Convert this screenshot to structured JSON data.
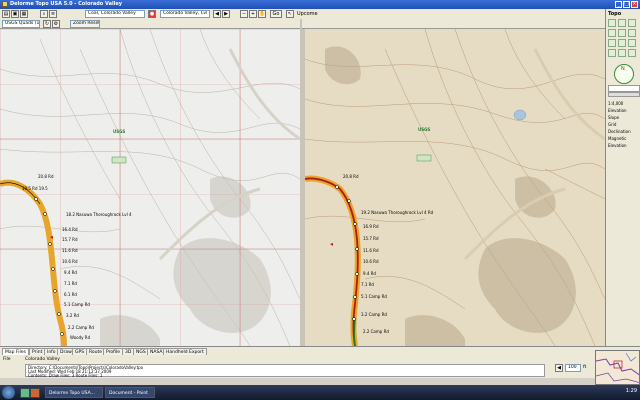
{
  "app": {
    "title": "Delorme Topo USA 5.0 - Colorado Valley",
    "icon": "app-icon",
    "window_controls": [
      "minimize-icon",
      "maximize-icon",
      "close-icon"
    ]
  },
  "toolbar": {
    "location_left": "Coal, Colorado Valley",
    "location_right": "Colorado Valley, Lvl 0 10",
    "zoom_label": "Go",
    "tab_label": "Upcome",
    "icons": [
      "open-icon",
      "save-icon",
      "print-icon",
      "find-icon",
      "layers-icon",
      "back-icon",
      "forward-icon"
    ]
  },
  "left_pane": {
    "map_source": "USGS Quads (1:24...)",
    "zoom_btn": "Zoom Reset",
    "region_label": "USGS",
    "labels": [
      {
        "text": "20.8 Rd"
      },
      {
        "text": "19.5 Rd 19.5"
      },
      {
        "text": "18.2 Nasuwa Thoroughrock Lvl 4"
      },
      {
        "text": "16.4 Rd"
      },
      {
        "text": "15.7 Rd"
      },
      {
        "text": "11.6 Rd"
      },
      {
        "text": "10.6 Rd"
      },
      {
        "text": "9.4 Rd"
      },
      {
        "text": "7.1 Rd"
      },
      {
        "text": "6.1 Rd"
      },
      {
        "text": "5.1 Camp Rd"
      },
      {
        "text": "3.2 Rd"
      },
      {
        "text": "2.2 Camp Rd"
      }
    ],
    "waypoint_labels": [
      "Woody Rd"
    ]
  },
  "right_pane": {
    "labels": [
      {
        "text": "20.8 Rd"
      },
      {
        "text": "19.2 Nasuwa Thoroughrock Lvl 4 Rd"
      },
      {
        "text": "16.9 Rd"
      },
      {
        "text": "15.7 Rd"
      },
      {
        "text": "11.6 Rd"
      },
      {
        "text": "10.6 Rd"
      },
      {
        "text": "9.4 Rd"
      },
      {
        "text": "7.1 Rd"
      },
      {
        "text": "5.1 Camp Rd"
      },
      {
        "text": "3.2 Camp Rd"
      },
      {
        "text": "2.2 Camp Rd"
      }
    ],
    "region_label": "USGS"
  },
  "side_panel": {
    "header": "Topo",
    "lines": [
      "1:4,000",
      "Elevation",
      "Slope",
      "Grid",
      "Declination",
      "Magnetic",
      "Elevation"
    ],
    "compass": "N"
  },
  "tabs": [
    {
      "label": "Map Files"
    },
    {
      "label": "Print"
    },
    {
      "label": "Info"
    },
    {
      "label": "Draw"
    },
    {
      "label": "GPS"
    },
    {
      "label": "Route"
    },
    {
      "label": "Profile"
    },
    {
      "label": "3D"
    },
    {
      "label": "NGS"
    },
    {
      "label": "NASA"
    },
    {
      "label": "Handheld Export"
    }
  ],
  "info": {
    "file_label": "File",
    "file_name": "Colorado Valley",
    "rows": [
      "Directory:  C:\\Documents\\Topo\\Projects\\ColoradoValley.tpo",
      "Last Modified:  Wed Feb 18 21:12:37 2009",
      "Contents:  Draw Files: 3  Route Files: 1"
    ],
    "scale_value": "100",
    "scale_unit": "ft"
  },
  "taskbar": {
    "items": [
      "Delorme Topo USA...",
      "Document - Paint"
    ],
    "clock": "1:29"
  },
  "colors": {
    "route_orange": "#e7a62b",
    "route_red": "#b21a1a",
    "route_green": "#1f7a1f",
    "title_blue": "#1f4fb3",
    "topo_left_bg": "#eeeeec",
    "topo_right_bg": "#e6dcc3"
  }
}
